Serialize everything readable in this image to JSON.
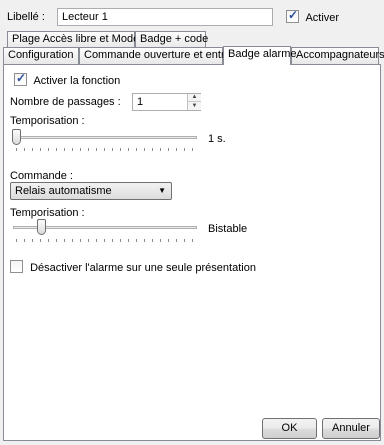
{
  "header": {
    "libelle_label": "Libellé :",
    "libelle_value": "Lecteur 1",
    "activer_label": "Activer",
    "activer_checked": true
  },
  "tabs_row1": [
    {
      "label": "Plage Accès libre et Mode"
    },
    {
      "label": "Badge + code"
    }
  ],
  "tabs_row2": [
    {
      "label": "Configuration"
    },
    {
      "label": "Commande ouverture et entrées"
    },
    {
      "label": "Badge alarme",
      "active": true
    },
    {
      "label": "Accompagnateurs"
    }
  ],
  "panel": {
    "activer_fonction_label": "Activer la fonction",
    "activer_fonction_checked": true,
    "nombre_passages_label": "Nombre de passages :",
    "nombre_passages_value": "1",
    "temporisation1_label": "Temporisation :",
    "temporisation1_value": "1 s.",
    "temporisation1_position_fraction": 0.0,
    "commande_label": "Commande :",
    "commande_value": "Relais automatisme",
    "temporisation2_label": "Temporisation :",
    "temporisation2_value": "Bistable",
    "temporisation2_position_fraction": 0.0,
    "desactiver_label": "Désactiver l'alarme sur une seule présentation",
    "desactiver_checked": false
  },
  "footer": {
    "ok_label": "OK",
    "annuler_label": "Annuler"
  }
}
